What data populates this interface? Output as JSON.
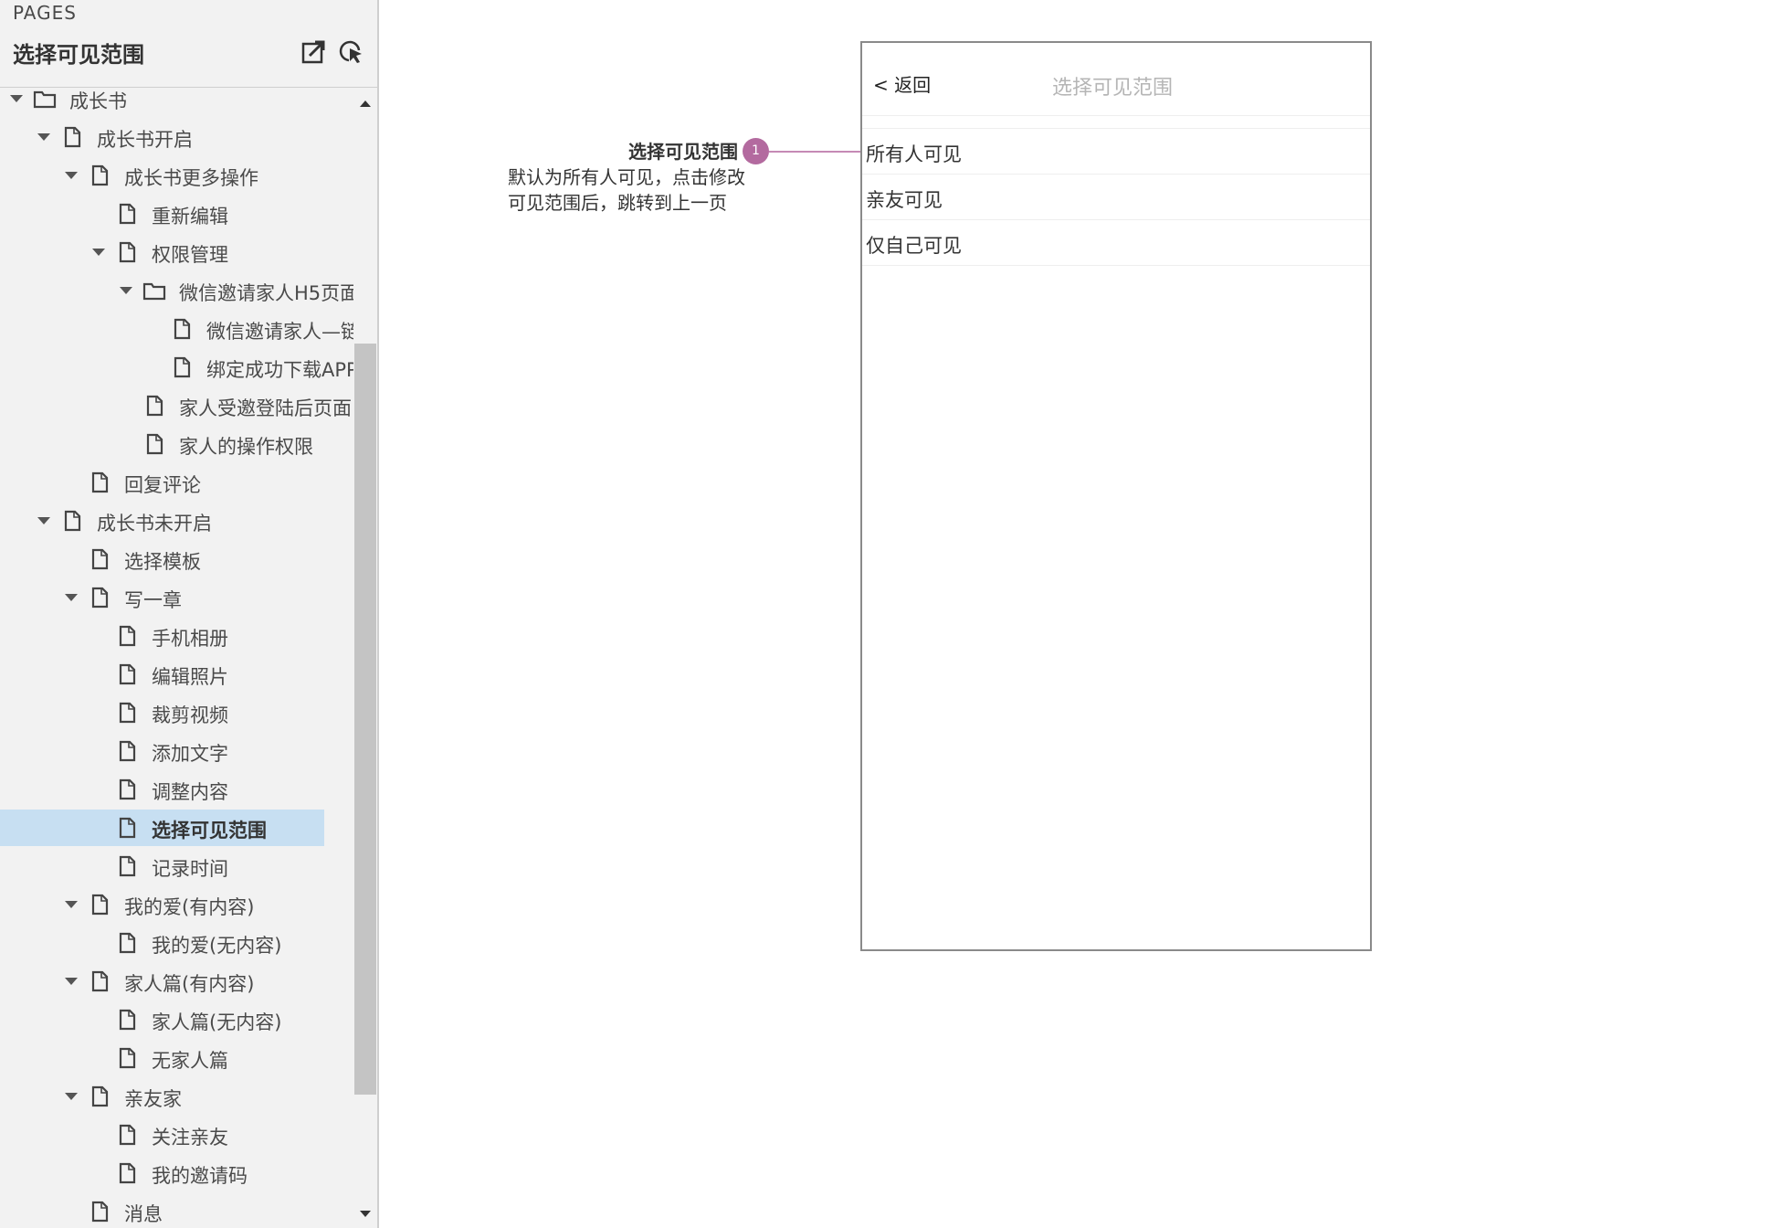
{
  "sidebar": {
    "header_label": "PAGES",
    "current_page_title": "选择可见范围",
    "tools": {
      "export_icon": "open-external-icon",
      "locate_icon": "locate-cursor-icon"
    },
    "tree": [
      {
        "label": "成长书",
        "level": 0,
        "kind": "folder",
        "expanded": true
      },
      {
        "label": "成长书开启",
        "level": 1,
        "kind": "page",
        "expanded": true
      },
      {
        "label": "成长书更多操作",
        "level": 2,
        "kind": "page",
        "expanded": true
      },
      {
        "label": "重新编辑",
        "level": 3,
        "kind": "page"
      },
      {
        "label": "权限管理",
        "level": 3,
        "kind": "page",
        "expanded": true
      },
      {
        "label": "微信邀请家人H5页面",
        "level": 4,
        "kind": "folder",
        "expanded": true
      },
      {
        "label": "微信邀请家人—链",
        "level": 5,
        "kind": "page"
      },
      {
        "label": "绑定成功下载APP",
        "level": 5,
        "kind": "page"
      },
      {
        "label": "家人受邀登陆后页面",
        "level": 4,
        "kind": "page"
      },
      {
        "label": "家人的操作权限",
        "level": 4,
        "kind": "page"
      },
      {
        "label": "回复评论",
        "level": 2,
        "kind": "page"
      },
      {
        "label": "成长书未开启",
        "level": 1,
        "kind": "page",
        "expanded": true
      },
      {
        "label": "选择模板",
        "level": 2,
        "kind": "page"
      },
      {
        "label": "写一章",
        "level": 2,
        "kind": "page",
        "expanded": true
      },
      {
        "label": "手机相册",
        "level": 3,
        "kind": "page"
      },
      {
        "label": "编辑照片",
        "level": 3,
        "kind": "page"
      },
      {
        "label": "裁剪视频",
        "level": 3,
        "kind": "page"
      },
      {
        "label": "添加文字",
        "level": 3,
        "kind": "page"
      },
      {
        "label": "调整内容",
        "level": 3,
        "kind": "page"
      },
      {
        "label": "选择可见范围",
        "level": 3,
        "kind": "page",
        "selected": true
      },
      {
        "label": "记录时间",
        "level": 3,
        "kind": "page"
      },
      {
        "label": "我的爱(有内容)",
        "level": 2,
        "kind": "page",
        "expanded": true
      },
      {
        "label": "我的爱(无内容)",
        "level": 3,
        "kind": "page"
      },
      {
        "label": "家人篇(有内容)",
        "level": 2,
        "kind": "page",
        "expanded": true
      },
      {
        "label": "家人篇(无内容)",
        "level": 3,
        "kind": "page"
      },
      {
        "label": "无家人篇",
        "level": 3,
        "kind": "page"
      },
      {
        "label": "亲友家",
        "level": 2,
        "kind": "page",
        "expanded": true
      },
      {
        "label": "关注亲友",
        "level": 3,
        "kind": "page"
      },
      {
        "label": "我的邀请码",
        "level": 3,
        "kind": "page"
      },
      {
        "label": "消息",
        "level": 2,
        "kind": "page"
      }
    ]
  },
  "annotation": {
    "title": "选择可见范围",
    "badge": "1",
    "description_lines": [
      "默认为所有人可见，点击修改",
      "可见范围后，跳转到上一页"
    ]
  },
  "phone": {
    "back_label": "< 返回",
    "nav_title": "选择可见范围",
    "options": [
      "所有人可见",
      "亲友可见",
      "仅自己可见"
    ]
  },
  "colors": {
    "sidebar_bg": "#f2f2f2",
    "selected_row": "#c7dff2",
    "annotation_badge": "#b36a9f",
    "nav_title_text": "#b5b5b5"
  }
}
